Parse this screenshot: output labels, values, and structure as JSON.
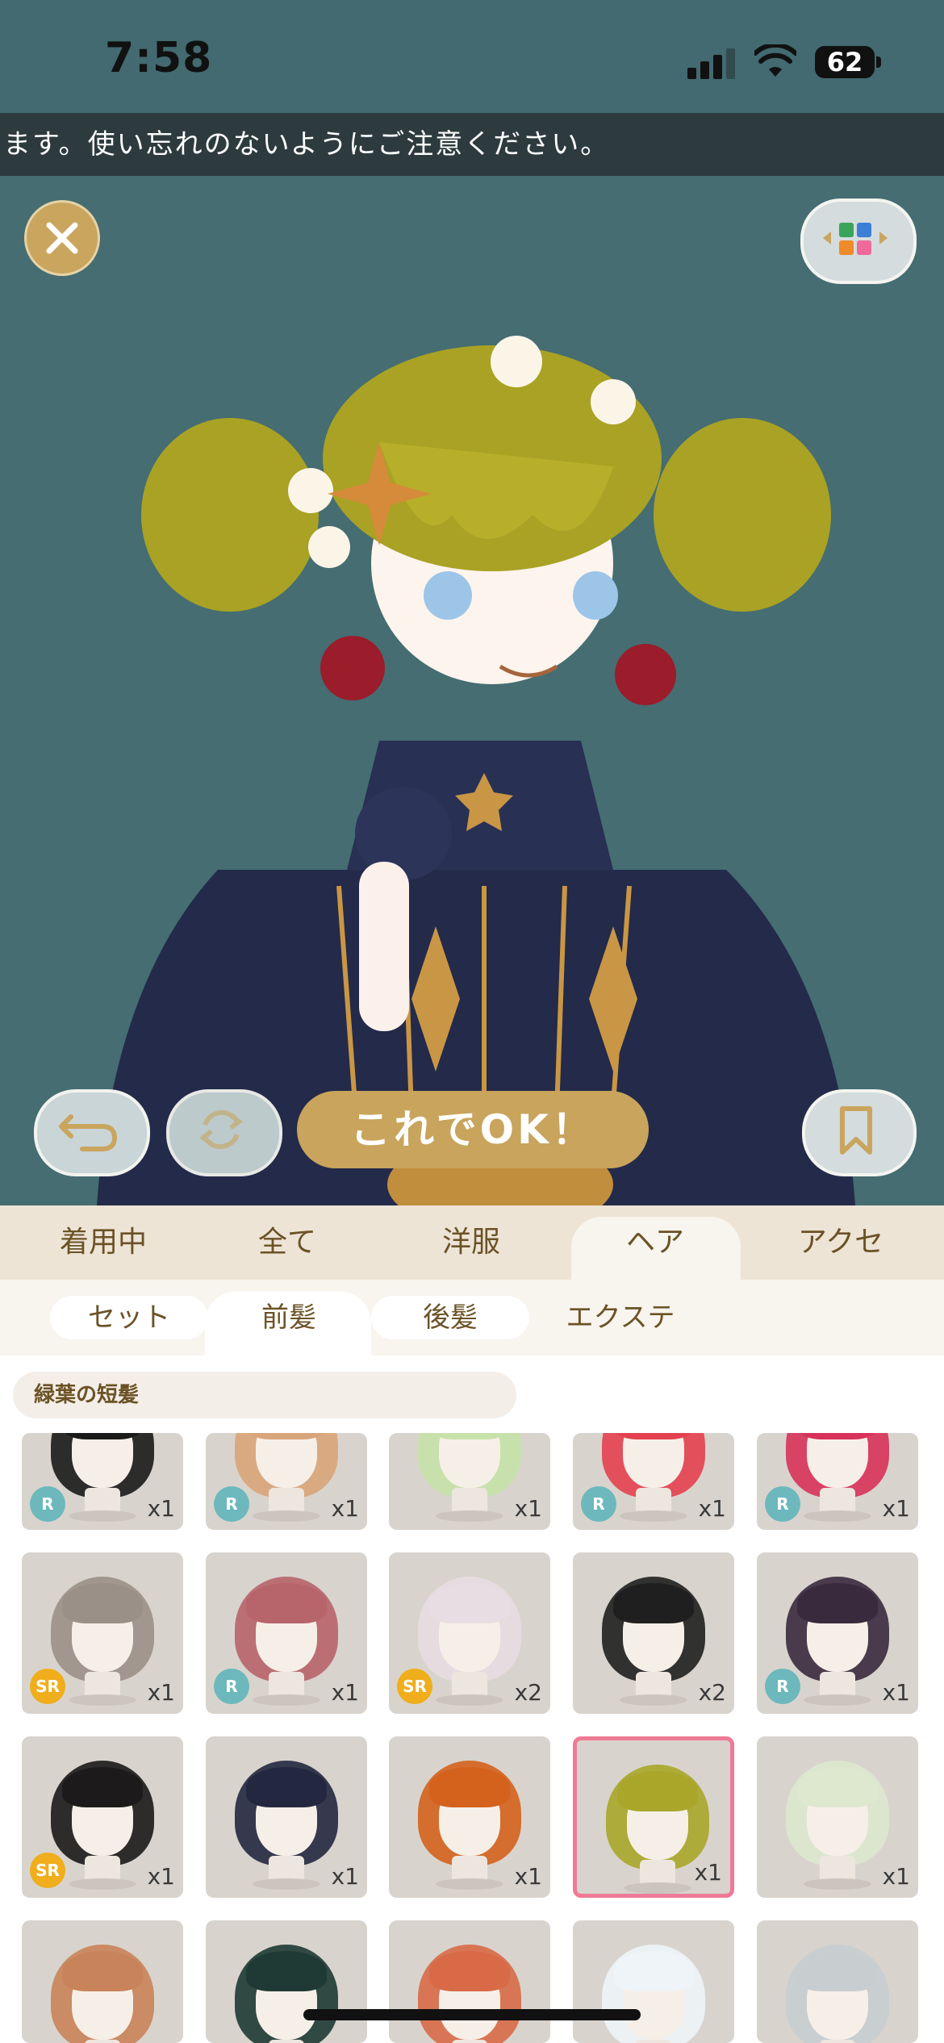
{
  "status_bar": {
    "time": "7:58",
    "battery": "62"
  },
  "banner": {
    "text": "ます。使い忘れのないようにご注意ください。"
  },
  "stage": {
    "ok_label": "これでOK！"
  },
  "category_tabs": [
    "着用中",
    "全て",
    "洋服",
    "ヘア",
    "アクセ"
  ],
  "category_active": "ヘア",
  "sub_tabs": [
    "セット",
    "前髪",
    "後髪",
    "エクステ"
  ],
  "sub_active": "前髪",
  "search": {
    "value": "緑葉の短髪"
  },
  "items": [
    {
      "rarity": "R",
      "count": "x1",
      "hair": "#1a1a1a"
    },
    {
      "rarity": "R",
      "count": "x1",
      "hair": "#d9a57a"
    },
    {
      "rarity": "",
      "count": "x1",
      "hair": "#c6e2a8"
    },
    {
      "rarity": "R",
      "count": "x1",
      "hair": "#e4404f"
    },
    {
      "rarity": "R",
      "count": "x1",
      "hair": "#d8325a"
    },
    {
      "rarity": "SR",
      "count": "x1",
      "hair": "#9b9088"
    },
    {
      "rarity": "R",
      "count": "x1",
      "hair": "#b8646b"
    },
    {
      "rarity": "SR",
      "count": "x2",
      "hair": "#e8dde2"
    },
    {
      "rarity": "",
      "count": "x2",
      "hair": "#1f1f1f"
    },
    {
      "rarity": "R",
      "count": "x1",
      "hair": "#3a2a3e"
    },
    {
      "rarity": "SR",
      "count": "x1",
      "hair": "#1c1a1a"
    },
    {
      "rarity": "",
      "count": "x1",
      "hair": "#232840"
    },
    {
      "rarity": "",
      "count": "x1",
      "hair": "#d4621c"
    },
    {
      "rarity": "",
      "count": "x1",
      "hair": "#a9a62a",
      "selected": true
    },
    {
      "rarity": "",
      "count": "x1",
      "hair": "#dde8cf"
    },
    {
      "rarity": "",
      "count": "",
      "hair": "#c9835a"
    },
    {
      "rarity": "",
      "count": "",
      "hair": "#1f3a34"
    },
    {
      "rarity": "",
      "count": "",
      "hair": "#d86a48"
    },
    {
      "rarity": "",
      "count": "",
      "hair": "#eef4f8"
    },
    {
      "rarity": "",
      "count": "",
      "hair": "#c8cdd0"
    }
  ],
  "colors": {
    "accent": "#c8a45c",
    "stage_bg": "#456d72",
    "selected_border": "#ef7a96"
  },
  "icons": [
    "close-icon",
    "color-grid-icon",
    "undo-icon",
    "shuffle-icon",
    "bookmark-icon",
    "cellular-icon",
    "wifi-icon",
    "battery-icon"
  ]
}
